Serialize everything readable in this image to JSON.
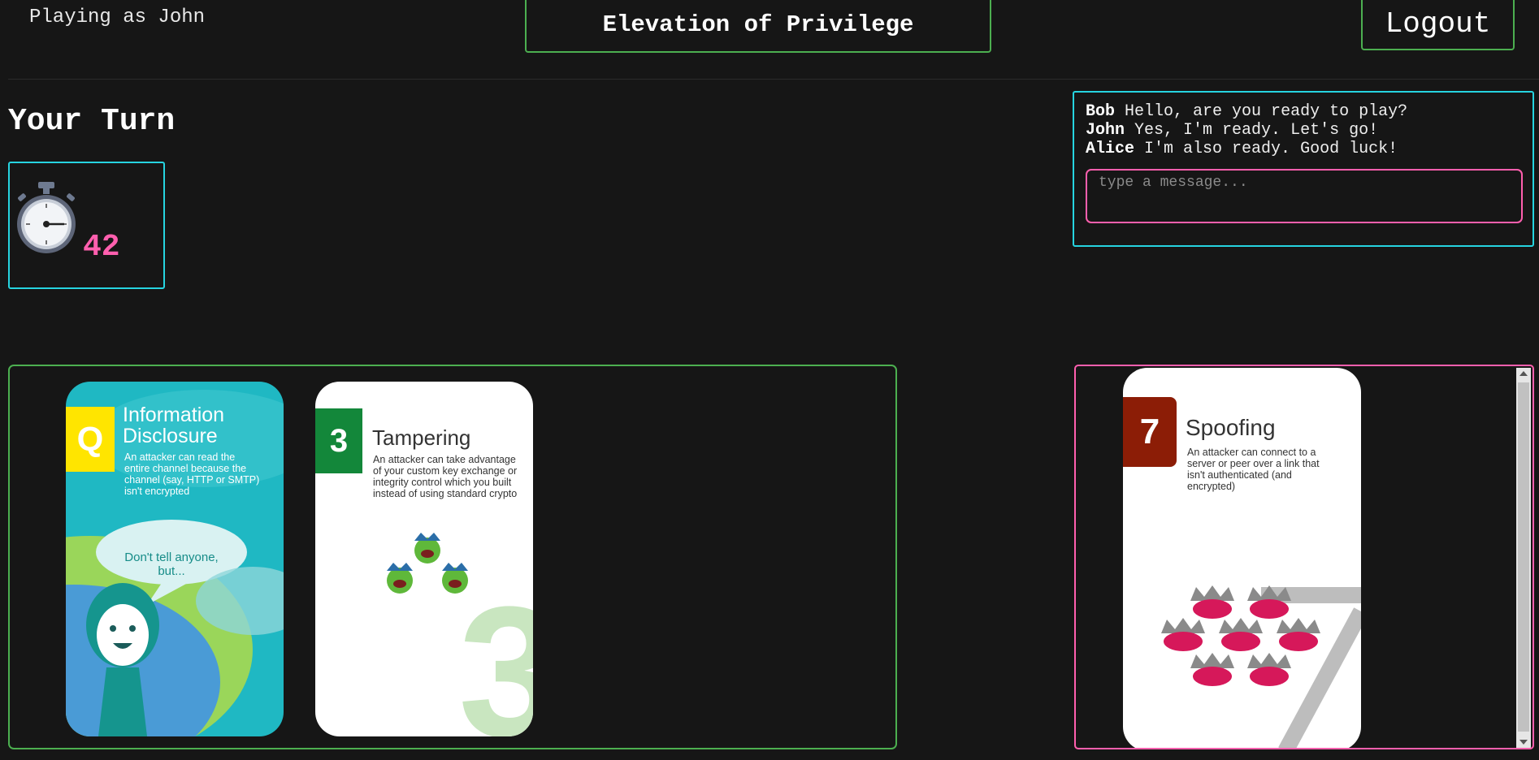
{
  "header": {
    "player_label": "Playing as John",
    "title": "Elevation of Privilege",
    "logout_label": "Logout"
  },
  "turn": {
    "label": "Your Turn",
    "timer_icon": "stopwatch-icon",
    "timer_value": "42"
  },
  "chat": {
    "messages": [
      {
        "sender": "Bob",
        "text": "Hello, are you ready to play?"
      },
      {
        "sender": "John",
        "text": "Yes, I'm ready. Let's go!"
      },
      {
        "sender": "Alice",
        "text": "I'm also ready. Good luck!"
      }
    ],
    "input_placeholder": "type a message..."
  },
  "hand": {
    "cards": [
      {
        "rank": "Q",
        "suit": "Information Disclosure",
        "title_line1": "Information",
        "title_line2": "Disclosure",
        "description": "An attacker can read the entire channel because the channel (say, HTTP or SMTP) isn't encrypted",
        "speech": "Don't tell anyone, but...",
        "color": "#1fb8c3",
        "badge_color": "#ffe500"
      },
      {
        "rank": "3",
        "suit": "Tampering",
        "title_line1": "Tampering",
        "description": "An attacker can take advantage of your custom key exchange or integrity control which you built instead of using standard crypto",
        "color": "#ffffff",
        "badge_color": "#13873a"
      }
    ]
  },
  "table": {
    "cards": [
      {
        "rank": "7",
        "suit": "Spoofing",
        "title_line1": "Spoofing",
        "description": "An attacker can connect to a server or peer over a link that isn't authenticated (and encrypted)",
        "color": "#ffffff",
        "badge_color": "#8c1d06"
      }
    ]
  },
  "colors": {
    "background": "#161616",
    "green_border": "#4caf50",
    "cyan_border": "#26d4e0",
    "pink_border": "#ff5fae",
    "timer_text": "#ff5fae"
  }
}
